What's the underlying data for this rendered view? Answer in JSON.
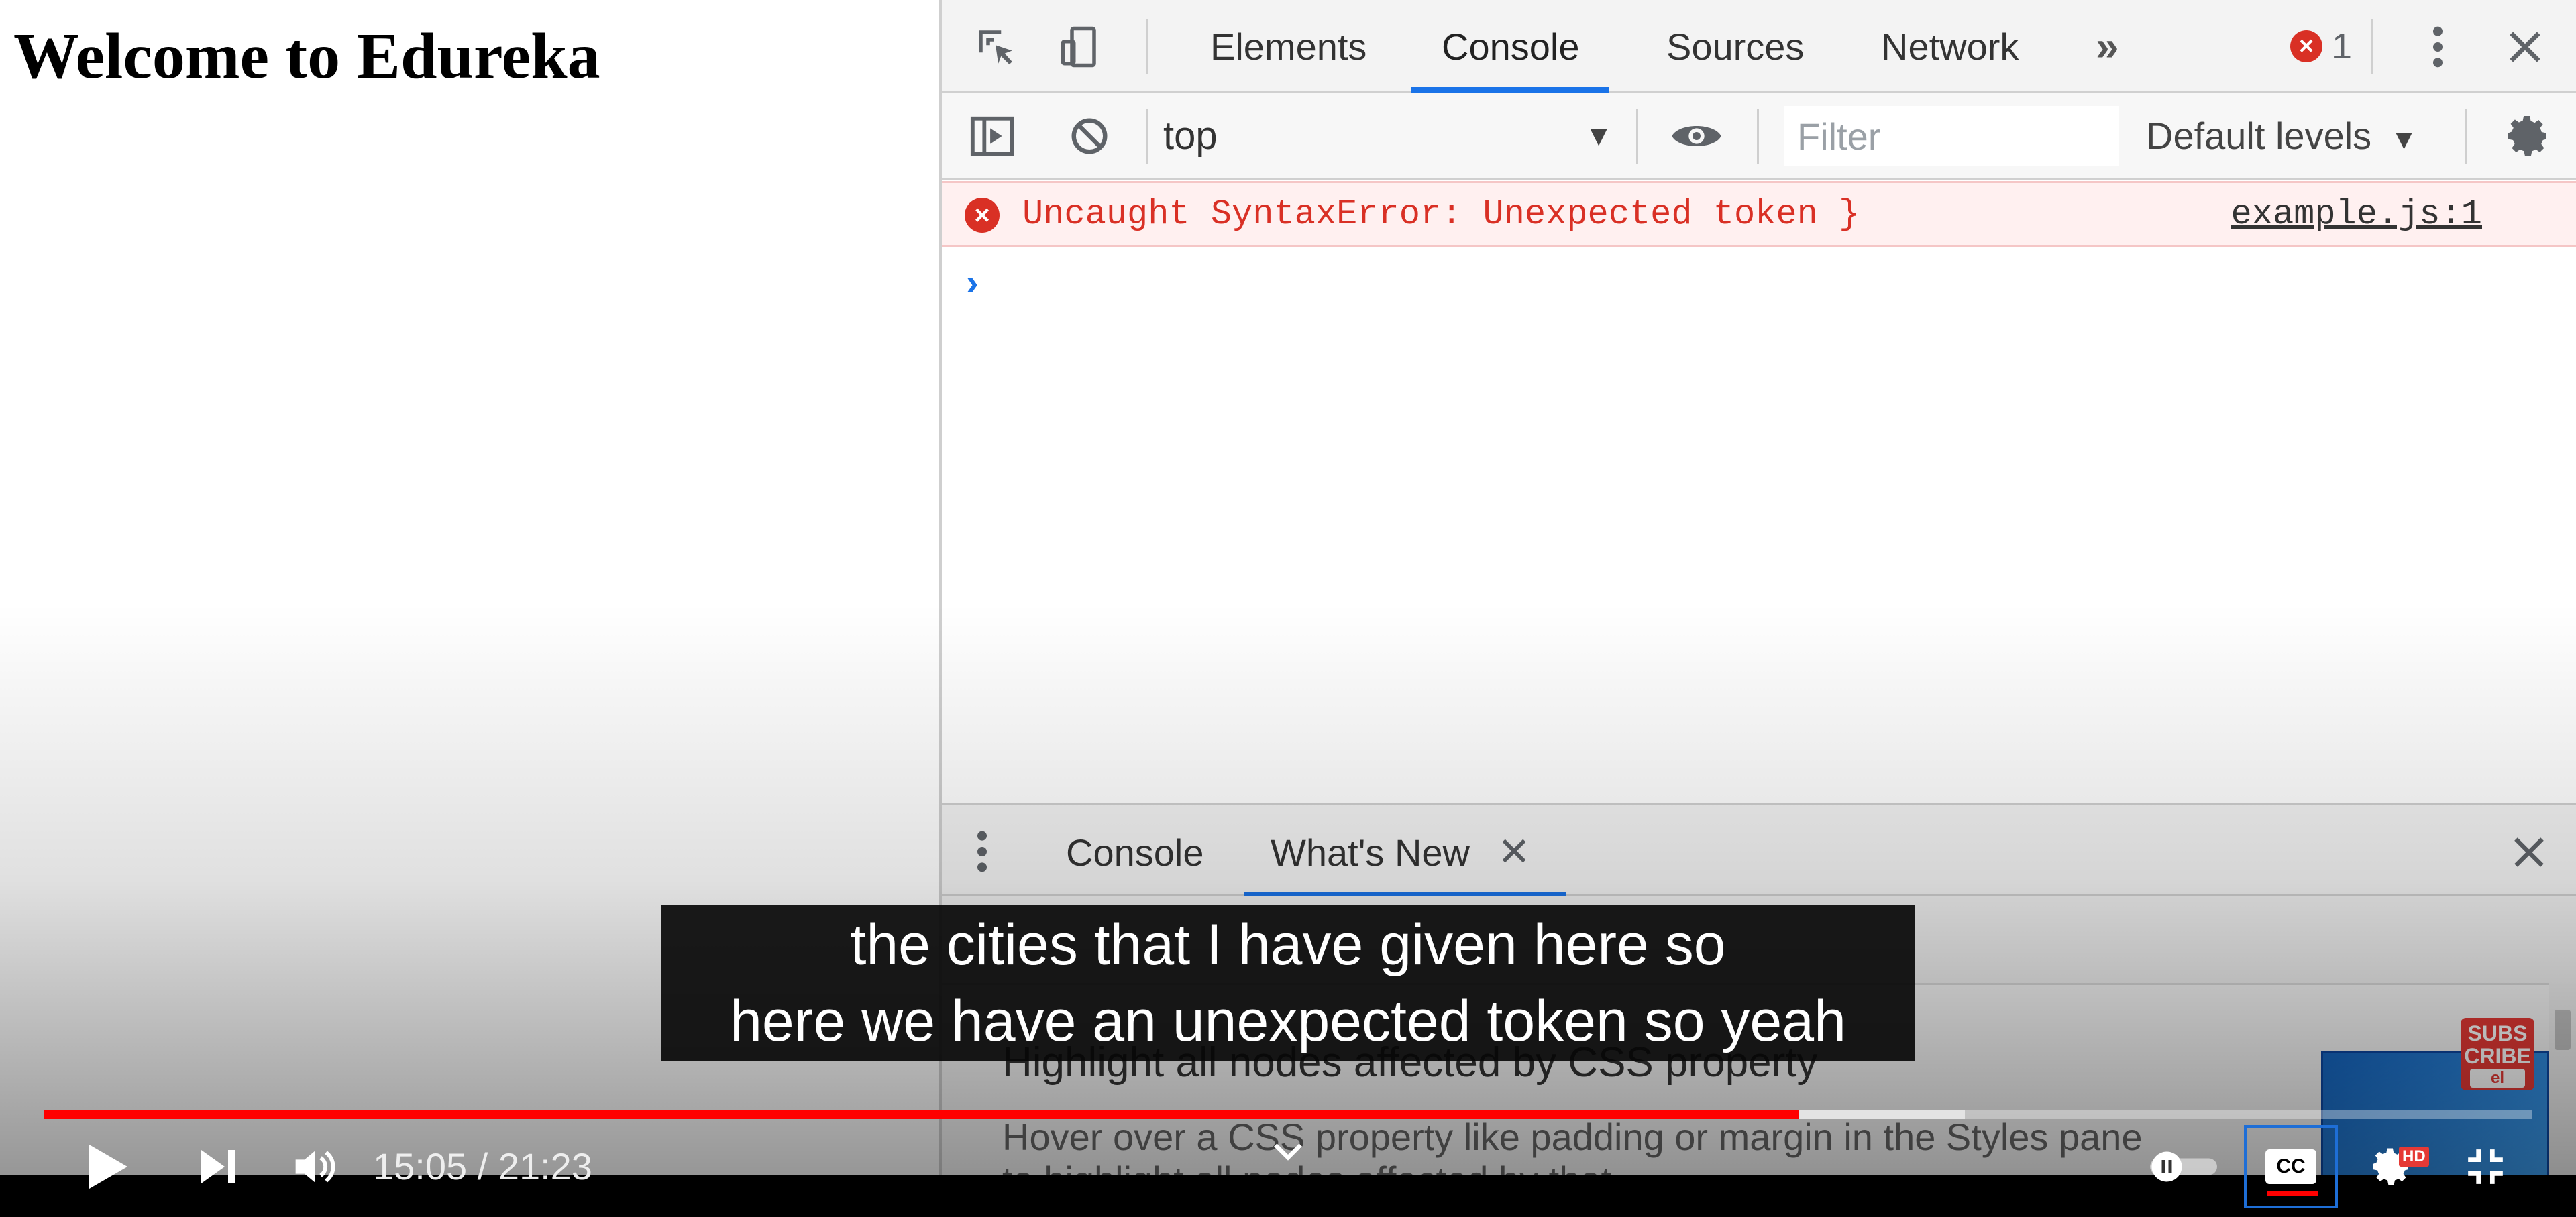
{
  "page": {
    "title": "Welcome to Edureka"
  },
  "devtools": {
    "tabs": [
      "Elements",
      "Console",
      "Sources",
      "Network"
    ],
    "more_tabs_label": "»",
    "error_badge_count": "1",
    "icons": [
      "inspect-element-icon",
      "device-toolbar-icon",
      "kebab-menu-icon",
      "close-icon"
    ]
  },
  "console_toolbar": {
    "context": "top",
    "filter_placeholder": "Filter",
    "levels": "Default levels"
  },
  "console": {
    "error_message": "Uncaught SyntaxError: Unexpected token }",
    "error_source": "example.js:1",
    "prompt": "›"
  },
  "drawer": {
    "tabs": [
      "Console",
      "What's New"
    ],
    "whats_new_title": "Highlight all nodes affected by CSS property",
    "whats_new_desc": "Hover over a CSS property like padding or margin in the Styles pane to highlight all nodes affected by that"
  },
  "video": {
    "caption_lines": [
      "the cities that I have given here so",
      "here we have an unexpected token so yeah"
    ],
    "current_time": "15:05",
    "duration": "21:23",
    "time_display": "15:05 / 21:23",
    "played_fraction": 0.705,
    "buffered_fraction": 0.772,
    "quality_badge": "HD",
    "cc_label": "CC",
    "subscribe_label": "SUBS CRIBE",
    "subscribe_mini": "el"
  },
  "colors": {
    "accent": "#1a73e8",
    "error": "#d93025",
    "progress": "#ff0000"
  }
}
